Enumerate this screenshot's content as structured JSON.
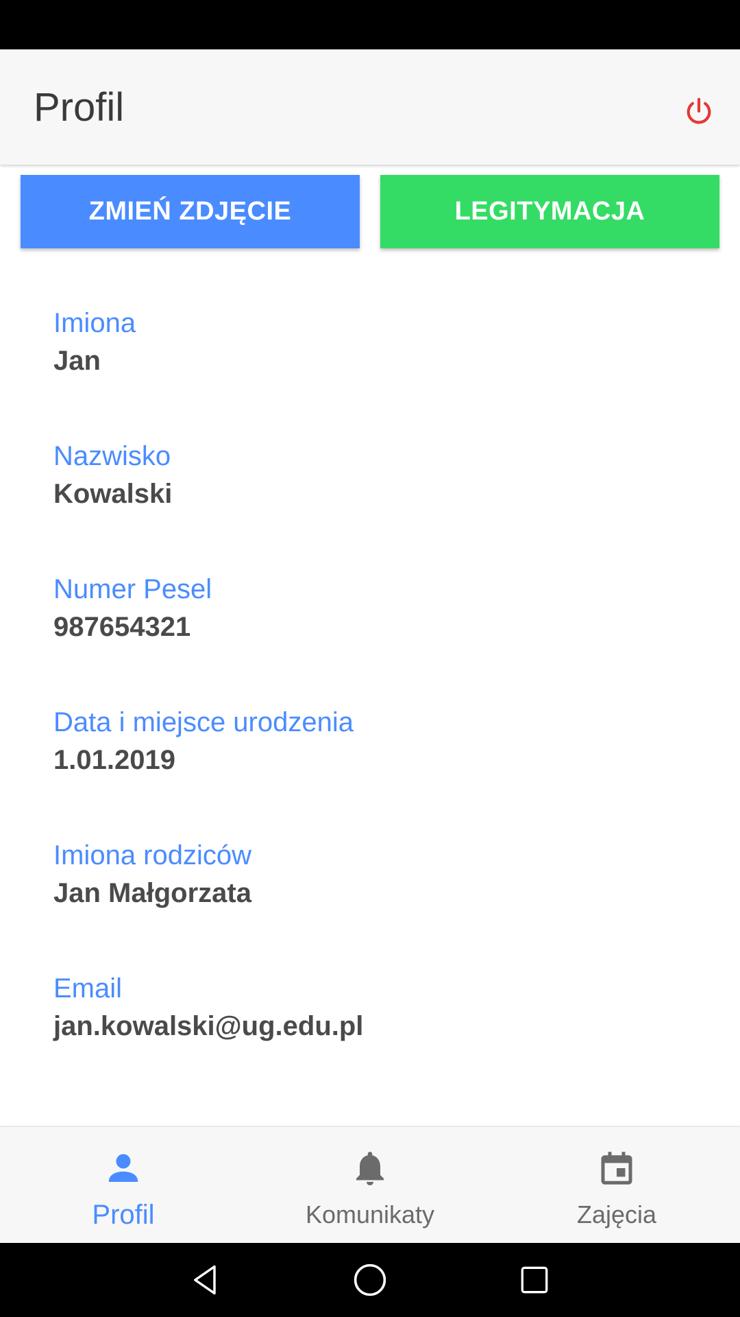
{
  "header": {
    "title": "Profil",
    "power_icon": "power-icon",
    "power_color": "#e53935"
  },
  "actions": {
    "change_photo_label": "ZMIEŃ ZDJĘCIE",
    "change_photo_color": "#4a8cff",
    "id_card_label": "LEGITYMACJA",
    "id_card_color": "#34dc65"
  },
  "fields": [
    {
      "label": "Imiona",
      "value": "Jan"
    },
    {
      "label": "Nazwisko",
      "value": "Kowalski"
    },
    {
      "label": "Numer Pesel",
      "value": "987654321"
    },
    {
      "label": "Data i miejsce urodzenia",
      "value": "1.01.2019"
    },
    {
      "label": "Imiona rodziców",
      "value": "Jan Małgorzata"
    },
    {
      "label": "Email",
      "value": "jan.kowalski@ug.edu.pl"
    }
  ],
  "bottom_nav": {
    "active_color": "#4a8cff",
    "inactive_color": "#6b6b6b",
    "items": [
      {
        "label": "Profil",
        "icon": "person-icon",
        "active": true
      },
      {
        "label": "Komunikaty",
        "icon": "bell-icon",
        "active": false
      },
      {
        "label": "Zajęcia",
        "icon": "calendar-icon",
        "active": false
      }
    ]
  },
  "system_nav": {
    "icons": [
      "back-icon",
      "home-icon",
      "recents-icon"
    ]
  }
}
